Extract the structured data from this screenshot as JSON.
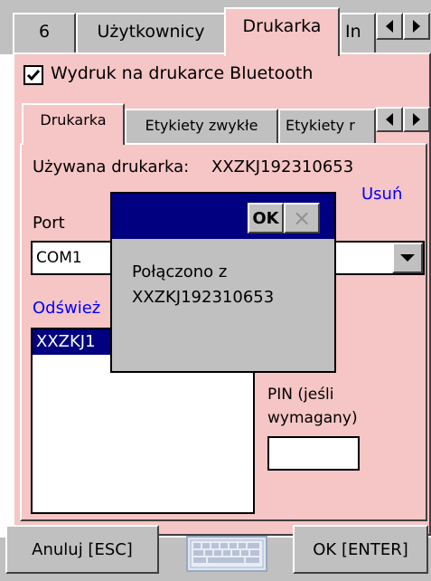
{
  "top_tabs": [
    "6",
    "Użytkownicy",
    "Drukarka",
    "In"
  ],
  "bluetooth_checkbox": {
    "label": "Wydruk na drukarce Bluetooth",
    "checked": true
  },
  "sub_tabs": [
    "Drukarka",
    "Etykiety zwykłe",
    "Etykiety r"
  ],
  "printer": {
    "used_label": "Używana drukarka:",
    "used_value": "XXZKJ192310653",
    "remove_link": "Usuń",
    "port_label": "Port",
    "port_value": "COM1",
    "refresh_link": "Odśwież",
    "device_list": [
      "XXZKJ1"
    ],
    "pin_label_line1": "PIN (jeśli",
    "pin_label_line2": "wymagany)",
    "pin_value": ""
  },
  "dialog": {
    "ok_label": "OK",
    "close_label": "×",
    "message_line1": "Połączono z",
    "message_line2": "XXZKJ192310653"
  },
  "footer": {
    "cancel_label": "Anuluj [ESC]",
    "ok_label": "OK [ENTER]"
  },
  "colors": {
    "panel_pink": "#f6c5c5",
    "dialog_title": "#000080",
    "link_blue": "#0000ff",
    "selection": "#000080"
  }
}
